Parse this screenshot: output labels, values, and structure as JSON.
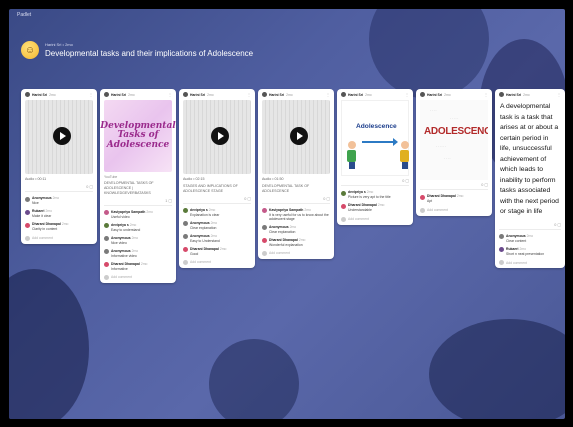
{
  "app": {
    "label": "Padlet"
  },
  "header": {
    "author_line": "Harini Sri  •  2mo",
    "title": "Developmental tasks and their implications of Adolescence"
  },
  "colors": {
    "background": "#4a5896",
    "card": "#ffffff",
    "accent": "#f5b82e"
  },
  "posts": [
    {
      "author": "Harini Sri",
      "time": "2mo",
      "media": "audio",
      "media_label": "Audio • 00:11",
      "title": "",
      "reactions": "0",
      "comments": [
        {
          "name": "Anonymous",
          "time": "2mo",
          "text": "Nice",
          "color": "#7a7a7a"
        },
        {
          "name": "Rukaeri",
          "time": "2mo",
          "text": "Make it clear",
          "color": "#6a4a8c"
        },
        {
          "name": "Dharani Dhanapal",
          "time": "2mo",
          "text": "Clarity in content",
          "color": "#d64a6a"
        }
      ],
      "add_comment": "Add comment"
    },
    {
      "author": "Harini Sri",
      "time": "2mo",
      "media": "youtube",
      "thumb_lines": [
        "Developmental",
        "Tasks of",
        "Adolescence"
      ],
      "source": "YouTube",
      "title": "DEVELOPMENTAL TASKS OF ADOLESCENCE | Knowledgeverbatasks",
      "reactions": "1",
      "comments": [
        {
          "name": "Kaviyapriya Sampath",
          "time": "2mo",
          "text": "Useful video",
          "color": "#c45a8a"
        },
        {
          "name": "devipriya s",
          "time": "2mo",
          "text": "Easy to understand",
          "color": "#5a7a3a"
        },
        {
          "name": "Anonymous",
          "time": "2mo",
          "text": "Nice video",
          "color": "#7a7a7a"
        },
        {
          "name": "Anonymous",
          "time": "2mo",
          "text": "Informative video",
          "color": "#7a7a7a"
        },
        {
          "name": "Dharani Dhanapal",
          "time": "2mo",
          "text": "Informative",
          "color": "#d64a6a"
        }
      ],
      "add_comment": "Add comment"
    },
    {
      "author": "Harini Sri",
      "time": "2mo",
      "media": "audio",
      "media_label": "Audio • 02:15",
      "title": "STAGES AND IMPLICATIONS OF ADOLESCENCE STAGE",
      "reactions": "0",
      "comments": [
        {
          "name": "devipriya s",
          "time": "2mo",
          "text": "Explanation is clear",
          "color": "#5a7a3a"
        },
        {
          "name": "Anonymous",
          "time": "2mo",
          "text": "Clear explanation",
          "color": "#7a7a7a"
        },
        {
          "name": "Anonymous",
          "time": "2mo",
          "text": "Easy to Understand",
          "color": "#7a7a7a"
        },
        {
          "name": "Dharani Dhanapal",
          "time": "2mo",
          "text": "Good",
          "color": "#d64a6a"
        }
      ],
      "add_comment": "Add comment"
    },
    {
      "author": "Harini Sri",
      "time": "2mo",
      "media": "audio",
      "media_label": "Audio • 01:50",
      "title": "DEVELOPMENTAL TASK OF ADOLESCENCE",
      "reactions": "0",
      "comments": [
        {
          "name": "Kaviyapriya Sampath",
          "time": "2mo",
          "text": "It is very useful for us to know about the adolescent stage",
          "color": "#c45a8a"
        },
        {
          "name": "Anonymous",
          "time": "2mo",
          "text": "Clear explanation",
          "color": "#7a7a7a"
        },
        {
          "name": "Dharani Dhanapal",
          "time": "2mo",
          "text": "Wonderful explanation",
          "color": "#d64a6a"
        }
      ],
      "add_comment": "Add comment"
    },
    {
      "author": "Harini Sri",
      "time": "2mo",
      "media": "image",
      "image_word": "Adolescence",
      "reactions": "0",
      "comments": [
        {
          "name": "devipriya s",
          "time": "2mo",
          "text": "Picture is very apt to the title",
          "color": "#5a7a3a"
        },
        {
          "name": "Dharani Dhanapal",
          "time": "2mo",
          "text": "Understandable",
          "color": "#d64a6a"
        }
      ],
      "add_comment": "Add comment"
    },
    {
      "author": "Harini Sri",
      "time": "2mo",
      "media": "wordcloud",
      "image_word": "ADOLESCENCE",
      "reactions": "0",
      "comments": [
        {
          "name": "Dharani Dhanapal",
          "time": "2mo",
          "text": "Apt",
          "color": "#d64a6a"
        }
      ],
      "add_comment": "Add comment"
    },
    {
      "author": "Harini Sri",
      "time": "2mo",
      "media": "text",
      "body": "A developmental task is a task that arises at or about a certain period in life, unsuccessful achievement of which leads to inability to perform tasks associated with the next period or stage in life",
      "reactions": "0",
      "comments": [
        {
          "name": "Anonymous",
          "time": "2mo",
          "text": "Clear content",
          "color": "#7a7a7a"
        },
        {
          "name": "Rukaeri",
          "time": "2mo",
          "text": "Short n neat presentation",
          "color": "#6a4a8c"
        }
      ],
      "add_comment": "Add comment"
    }
  ]
}
